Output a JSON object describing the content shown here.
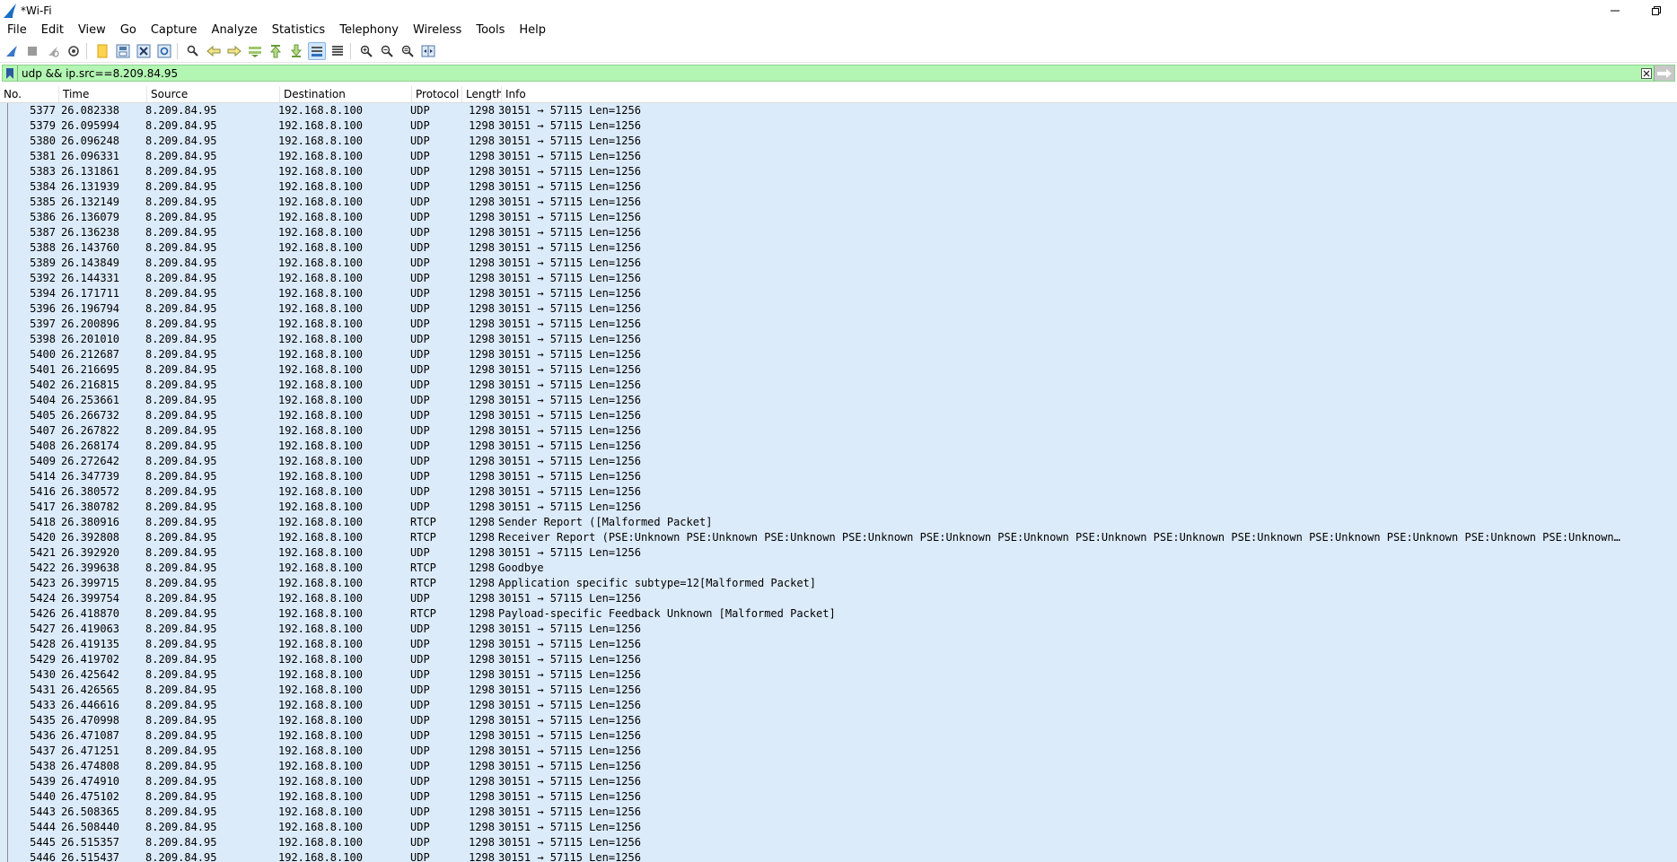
{
  "window": {
    "title": "*Wi-Fi"
  },
  "menu": [
    "File",
    "Edit",
    "View",
    "Go",
    "Capture",
    "Analyze",
    "Statistics",
    "Telephony",
    "Wireless",
    "Tools",
    "Help"
  ],
  "toolbar_icons": [
    "shark-fin-start-icon",
    "stop-icon",
    "restart-icon",
    "options-icon",
    "open-file-icon",
    "save-file-icon",
    "close-file-icon",
    "reload-icon",
    "find-packet-icon",
    "go-back-icon",
    "go-forward-icon",
    "go-to-packet-icon",
    "go-first-icon",
    "go-last-icon",
    "autoscroll-icon",
    "colorize-icon",
    "zoom-in-icon",
    "zoom-out-icon",
    "zoom-normal-icon",
    "resize-columns-icon"
  ],
  "filter": {
    "value": "udp && ip.src==8.209.84.95"
  },
  "columns": [
    "No.",
    "Time",
    "Source",
    "Destination",
    "Protocol",
    "Length",
    "Info"
  ],
  "packets": [
    [
      "5377",
      "26.082338",
      "8.209.84.95",
      "192.168.8.100",
      "UDP",
      "1298",
      "30151 → 57115 Len=1256"
    ],
    [
      "5379",
      "26.095994",
      "8.209.84.95",
      "192.168.8.100",
      "UDP",
      "1298",
      "30151 → 57115 Len=1256"
    ],
    [
      "5380",
      "26.096248",
      "8.209.84.95",
      "192.168.8.100",
      "UDP",
      "1298",
      "30151 → 57115 Len=1256"
    ],
    [
      "5381",
      "26.096331",
      "8.209.84.95",
      "192.168.8.100",
      "UDP",
      "1298",
      "30151 → 57115 Len=1256"
    ],
    [
      "5383",
      "26.131861",
      "8.209.84.95",
      "192.168.8.100",
      "UDP",
      "1298",
      "30151 → 57115 Len=1256"
    ],
    [
      "5384",
      "26.131939",
      "8.209.84.95",
      "192.168.8.100",
      "UDP",
      "1298",
      "30151 → 57115 Len=1256"
    ],
    [
      "5385",
      "26.132149",
      "8.209.84.95",
      "192.168.8.100",
      "UDP",
      "1298",
      "30151 → 57115 Len=1256"
    ],
    [
      "5386",
      "26.136079",
      "8.209.84.95",
      "192.168.8.100",
      "UDP",
      "1298",
      "30151 → 57115 Len=1256"
    ],
    [
      "5387",
      "26.136238",
      "8.209.84.95",
      "192.168.8.100",
      "UDP",
      "1298",
      "30151 → 57115 Len=1256"
    ],
    [
      "5388",
      "26.143760",
      "8.209.84.95",
      "192.168.8.100",
      "UDP",
      "1298",
      "30151 → 57115 Len=1256"
    ],
    [
      "5389",
      "26.143849",
      "8.209.84.95",
      "192.168.8.100",
      "UDP",
      "1298",
      "30151 → 57115 Len=1256"
    ],
    [
      "5392",
      "26.144331",
      "8.209.84.95",
      "192.168.8.100",
      "UDP",
      "1298",
      "30151 → 57115 Len=1256"
    ],
    [
      "5394",
      "26.171711",
      "8.209.84.95",
      "192.168.8.100",
      "UDP",
      "1298",
      "30151 → 57115 Len=1256"
    ],
    [
      "5396",
      "26.196794",
      "8.209.84.95",
      "192.168.8.100",
      "UDP",
      "1298",
      "30151 → 57115 Len=1256"
    ],
    [
      "5397",
      "26.200896",
      "8.209.84.95",
      "192.168.8.100",
      "UDP",
      "1298",
      "30151 → 57115 Len=1256"
    ],
    [
      "5398",
      "26.201010",
      "8.209.84.95",
      "192.168.8.100",
      "UDP",
      "1298",
      "30151 → 57115 Len=1256"
    ],
    [
      "5400",
      "26.212687",
      "8.209.84.95",
      "192.168.8.100",
      "UDP",
      "1298",
      "30151 → 57115 Len=1256"
    ],
    [
      "5401",
      "26.216695",
      "8.209.84.95",
      "192.168.8.100",
      "UDP",
      "1298",
      "30151 → 57115 Len=1256"
    ],
    [
      "5402",
      "26.216815",
      "8.209.84.95",
      "192.168.8.100",
      "UDP",
      "1298",
      "30151 → 57115 Len=1256"
    ],
    [
      "5404",
      "26.253661",
      "8.209.84.95",
      "192.168.8.100",
      "UDP",
      "1298",
      "30151 → 57115 Len=1256"
    ],
    [
      "5405",
      "26.266732",
      "8.209.84.95",
      "192.168.8.100",
      "UDP",
      "1298",
      "30151 → 57115 Len=1256"
    ],
    [
      "5407",
      "26.267822",
      "8.209.84.95",
      "192.168.8.100",
      "UDP",
      "1298",
      "30151 → 57115 Len=1256"
    ],
    [
      "5408",
      "26.268174",
      "8.209.84.95",
      "192.168.8.100",
      "UDP",
      "1298",
      "30151 → 57115 Len=1256"
    ],
    [
      "5409",
      "26.272642",
      "8.209.84.95",
      "192.168.8.100",
      "UDP",
      "1298",
      "30151 → 57115 Len=1256"
    ],
    [
      "5414",
      "26.347739",
      "8.209.84.95",
      "192.168.8.100",
      "UDP",
      "1298",
      "30151 → 57115 Len=1256"
    ],
    [
      "5416",
      "26.380572",
      "8.209.84.95",
      "192.168.8.100",
      "UDP",
      "1298",
      "30151 → 57115 Len=1256"
    ],
    [
      "5417",
      "26.380782",
      "8.209.84.95",
      "192.168.8.100",
      "UDP",
      "1298",
      "30151 → 57115 Len=1256"
    ],
    [
      "5418",
      "26.380916",
      "8.209.84.95",
      "192.168.8.100",
      "RTCP",
      "1298",
      "Sender Report   ([Malformed Packet]"
    ],
    [
      "5420",
      "26.392808",
      "8.209.84.95",
      "192.168.8.100",
      "RTCP",
      "1298",
      "Receiver Report   (PSE:Unknown  PSE:Unknown  PSE:Unknown  PSE:Unknown  PSE:Unknown  PSE:Unknown  PSE:Unknown  PSE:Unknown  PSE:Unknown  PSE:Unknown  PSE:Unknown  PSE:Unknown  PSE:Unknown…"
    ],
    [
      "5421",
      "26.392920",
      "8.209.84.95",
      "192.168.8.100",
      "UDP",
      "1298",
      "30151 → 57115 Len=1256"
    ],
    [
      "5422",
      "26.399638",
      "8.209.84.95",
      "192.168.8.100",
      "RTCP",
      "1298",
      "Goodbye"
    ],
    [
      "5423",
      "26.399715",
      "8.209.84.95",
      "192.168.8.100",
      "RTCP",
      "1298",
      "Application specific   subtype=12[Malformed Packet]"
    ],
    [
      "5424",
      "26.399754",
      "8.209.84.95",
      "192.168.8.100",
      "UDP",
      "1298",
      "30151 → 57115 Len=1256"
    ],
    [
      "5426",
      "26.418870",
      "8.209.84.95",
      "192.168.8.100",
      "RTCP",
      "1298",
      "Payload-specific Feedback   Unknown  [Malformed Packet]"
    ],
    [
      "5427",
      "26.419063",
      "8.209.84.95",
      "192.168.8.100",
      "UDP",
      "1298",
      "30151 → 57115 Len=1256"
    ],
    [
      "5428",
      "26.419135",
      "8.209.84.95",
      "192.168.8.100",
      "UDP",
      "1298",
      "30151 → 57115 Len=1256"
    ],
    [
      "5429",
      "26.419702",
      "8.209.84.95",
      "192.168.8.100",
      "UDP",
      "1298",
      "30151 → 57115 Len=1256"
    ],
    [
      "5430",
      "26.425642",
      "8.209.84.95",
      "192.168.8.100",
      "UDP",
      "1298",
      "30151 → 57115 Len=1256"
    ],
    [
      "5431",
      "26.426565",
      "8.209.84.95",
      "192.168.8.100",
      "UDP",
      "1298",
      "30151 → 57115 Len=1256"
    ],
    [
      "5433",
      "26.446616",
      "8.209.84.95",
      "192.168.8.100",
      "UDP",
      "1298",
      "30151 → 57115 Len=1256"
    ],
    [
      "5435",
      "26.470998",
      "8.209.84.95",
      "192.168.8.100",
      "UDP",
      "1298",
      "30151 → 57115 Len=1256"
    ],
    [
      "5436",
      "26.471087",
      "8.209.84.95",
      "192.168.8.100",
      "UDP",
      "1298",
      "30151 → 57115 Len=1256"
    ],
    [
      "5437",
      "26.471251",
      "8.209.84.95",
      "192.168.8.100",
      "UDP",
      "1298",
      "30151 → 57115 Len=1256"
    ],
    [
      "5438",
      "26.474808",
      "8.209.84.95",
      "192.168.8.100",
      "UDP",
      "1298",
      "30151 → 57115 Len=1256"
    ],
    [
      "5439",
      "26.474910",
      "8.209.84.95",
      "192.168.8.100",
      "UDP",
      "1298",
      "30151 → 57115 Len=1256"
    ],
    [
      "5440",
      "26.475102",
      "8.209.84.95",
      "192.168.8.100",
      "UDP",
      "1298",
      "30151 → 57115 Len=1256"
    ],
    [
      "5443",
      "26.508365",
      "8.209.84.95",
      "192.168.8.100",
      "UDP",
      "1298",
      "30151 → 57115 Len=1256"
    ],
    [
      "5444",
      "26.508440",
      "8.209.84.95",
      "192.168.8.100",
      "UDP",
      "1298",
      "30151 → 57115 Len=1256"
    ],
    [
      "5445",
      "26.515357",
      "8.209.84.95",
      "192.168.8.100",
      "UDP",
      "1298",
      "30151 → 57115 Len=1256"
    ],
    [
      "5446",
      "26.515437",
      "8.209.84.95",
      "192.168.8.100",
      "UDP",
      "1298",
      "30151 → 57115 Len=1256"
    ]
  ],
  "colors": {
    "row_background": "#dcebfa",
    "filter_valid": "#b3f5b3"
  }
}
